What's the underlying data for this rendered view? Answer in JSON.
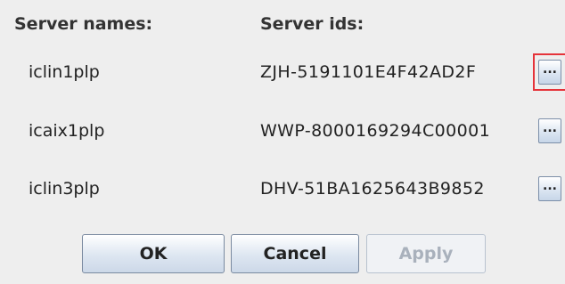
{
  "headers": {
    "server_names": "Server names:",
    "server_ids": "Server ids:"
  },
  "servers": [
    {
      "name": "iclin1plp",
      "id": "ZJH-5191101E4F42AD2F",
      "browse_label": "..."
    },
    {
      "name": "icaix1plp",
      "id": "WWP-8000169294C00001",
      "browse_label": "..."
    },
    {
      "name": "iclin3plp",
      "id": "DHV-51BA1625643B9852",
      "browse_label": "..."
    }
  ],
  "buttons": {
    "ok": "OK",
    "cancel": "Cancel",
    "apply": "Apply"
  },
  "colors": {
    "focus_highlight": "#e5333a",
    "button_border": "#7a8aa0",
    "disabled_text": "#a9b1bc",
    "background": "#eeeeee"
  }
}
